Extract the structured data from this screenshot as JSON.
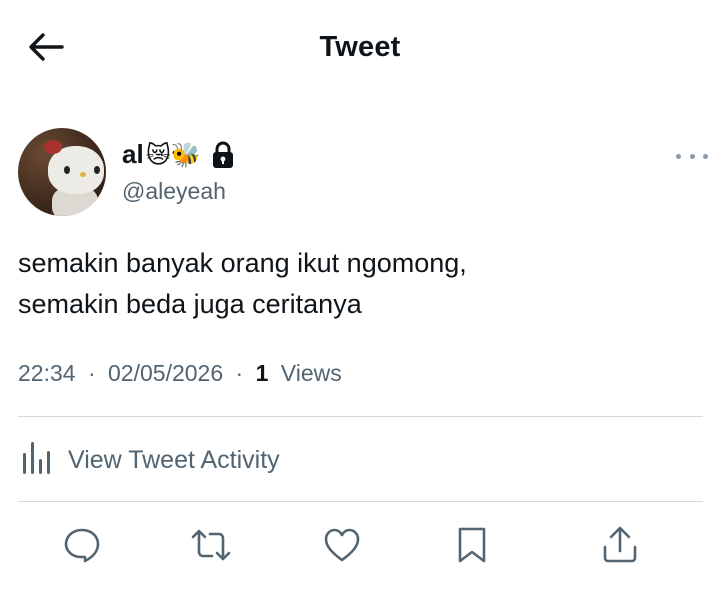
{
  "header": {
    "title": "Tweet",
    "back_icon": "arrow-left-icon"
  },
  "tweet": {
    "author": {
      "name": "al",
      "name_emojis": "😿🐝",
      "handle": "@aleyeah",
      "protected": true,
      "avatar": "hello-kitty-plush-avatar"
    },
    "text_lines": [
      "semakin banyak orang ikut ngomong,",
      "semakin beda juga ceritanya"
    ],
    "time": "22:34",
    "date": "02/05/2026",
    "separator": "·",
    "views_count": "1",
    "views_label": "Views"
  },
  "activity": {
    "label": "View Tweet Activity",
    "icon": "bar-chart-icon"
  },
  "actions": [
    {
      "name": "reply",
      "icon": "reply-icon"
    },
    {
      "name": "retweet",
      "icon": "retweet-icon"
    },
    {
      "name": "like",
      "icon": "heart-icon"
    },
    {
      "name": "bookmark",
      "icon": "bookmark-icon"
    },
    {
      "name": "share",
      "icon": "share-icon"
    }
  ],
  "colors": {
    "text_primary": "#0f1419",
    "text_secondary": "#536471",
    "divider": "#cfd9de",
    "background": "#ffffff"
  }
}
